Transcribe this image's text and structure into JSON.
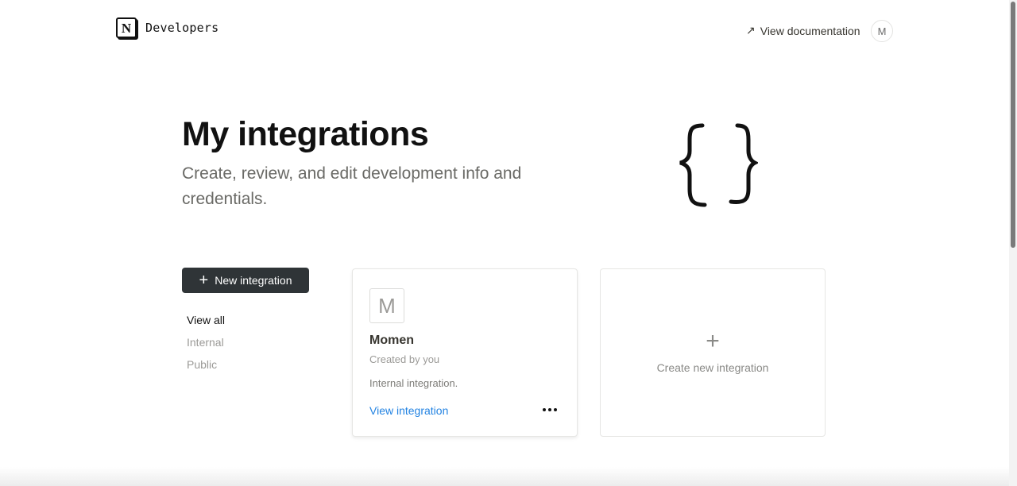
{
  "header": {
    "brand_logo_letter": "N",
    "brand_text": "Developers",
    "doc_link_label": "View documentation",
    "avatar_initial": "M"
  },
  "hero": {
    "title": "My integrations",
    "subtitle": "Create, review, and edit development info and credentials.",
    "illustration": "curly-braces-icon"
  },
  "sidebar": {
    "new_button_label": "New integration",
    "filters": [
      {
        "label": "View all",
        "active": true
      },
      {
        "label": "Internal",
        "active": false
      },
      {
        "label": "Public",
        "active": false
      }
    ]
  },
  "integrations": [
    {
      "icon_letter": "M",
      "name": "Momen",
      "creator": "Created by you",
      "description": "Internal integration.",
      "link_label": "View integration"
    }
  ],
  "create_card": {
    "label": "Create new integration"
  },
  "colors": {
    "button_bg": "#2f3437",
    "link": "#2383e2",
    "muted": "#9b9a97"
  }
}
